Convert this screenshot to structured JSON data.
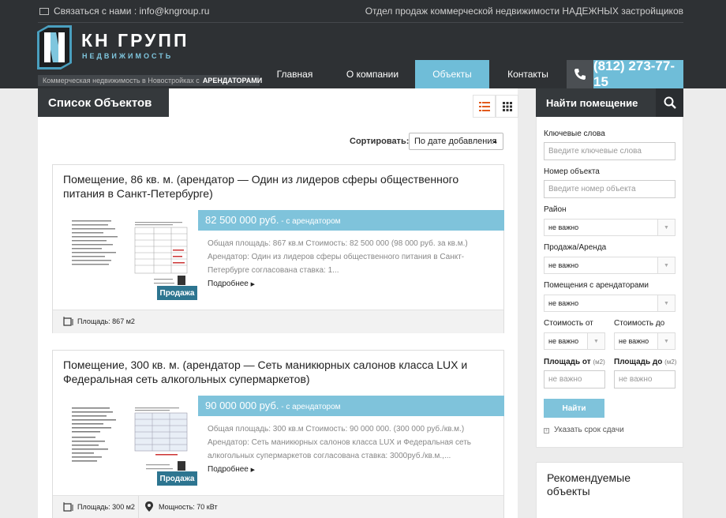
{
  "header": {
    "contact_prefix": "Связаться с нами :",
    "contact_email": "info@kngroup.ru",
    "tagline": "Отдел продаж коммерческой недвижимости НАДЕЖНЫХ застройщиков",
    "logo_title": "КН ГРУПП",
    "logo_subtitle": "НЕДВИЖИМОСТЬ",
    "strip_text": "Коммерческая недвижимость в Новостройках с",
    "strip_bold": "АРЕНДАТОРАМИ",
    "phone": "(812) 273-77-15",
    "icons": {
      "contact": "envelope-icon",
      "phone": "phone-icon"
    }
  },
  "nav": [
    "Главная",
    "О компании",
    "Объекты",
    "Контакты"
  ],
  "nav_active": "Объекты",
  "main": {
    "title": "Список Объектов",
    "sort_label": "Сортировать:",
    "sort_value": "По дате добавления"
  },
  "cards": [
    {
      "title": "Помещение, 86 кв. м. (арендатор — Один из лидеров сферы общественного питания в Санкт-Петербурге)",
      "price": "82 500 000 руб.",
      "price_suffix": " - с арендатором",
      "desc": "Общая площадь: 867  кв.м Стоимость: 82 500 000 (98 000 руб. за кв.м.) Арендатор: Один из лидеров сферы общественного питания в Санкт-Петербурге согласована ставка: 1...",
      "more": "Подробнее",
      "badge": "Продажа",
      "area": "Площадь: 867 м2"
    },
    {
      "title": "Помещение, 300 кв. м. (арендатор — Сеть маникюрных салонов класса LUX и Федеральная сеть алкогольных супермаркетов)",
      "price": "90 000 000 руб.",
      "price_suffix": " - с арендатором",
      "desc": "Общая площадь: 300 кв.м Стоимость: 90 000 000. (300 000 руб./кв.м.) Арендатор: Сеть маникюрных салонов класса LUX и Федеральная сеть алкогольных супермаркетов согласована ставка: 3000руб./кв.м.,...",
      "more": "Подробнее",
      "badge": "Продажа",
      "area": "Площадь: 300 м2",
      "power": "Мощность: 70 кВт"
    }
  ],
  "sidebar": {
    "title": "Найти помещение",
    "keywords_label": "Ключевые слова",
    "keywords_placeholder": "Введите ключевые слова",
    "number_label": "Номер объекта",
    "number_placeholder": "Введите номер объекта",
    "district_label": "Район",
    "district_value": "не важно",
    "deal_label": "Продажа/Аренда",
    "deal_value": "не важно",
    "tenants_label": "Помещения с арендаторами",
    "tenants_value": "не важно",
    "price_from_label": "Стоимость от",
    "price_from_value": "не важно",
    "price_to_label": "Стоимость до",
    "price_to_value": "не важно",
    "area_from_label": "Площадь от",
    "area_to_label": "Площадь до",
    "area_unit": "(м2)",
    "area_from_placeholder": "не важно",
    "area_to_placeholder": "не важно",
    "find_button": "Найти",
    "deadline_link": "Указать срок сдачи"
  },
  "recommended": {
    "title": "Рекомендуемые объекты"
  }
}
